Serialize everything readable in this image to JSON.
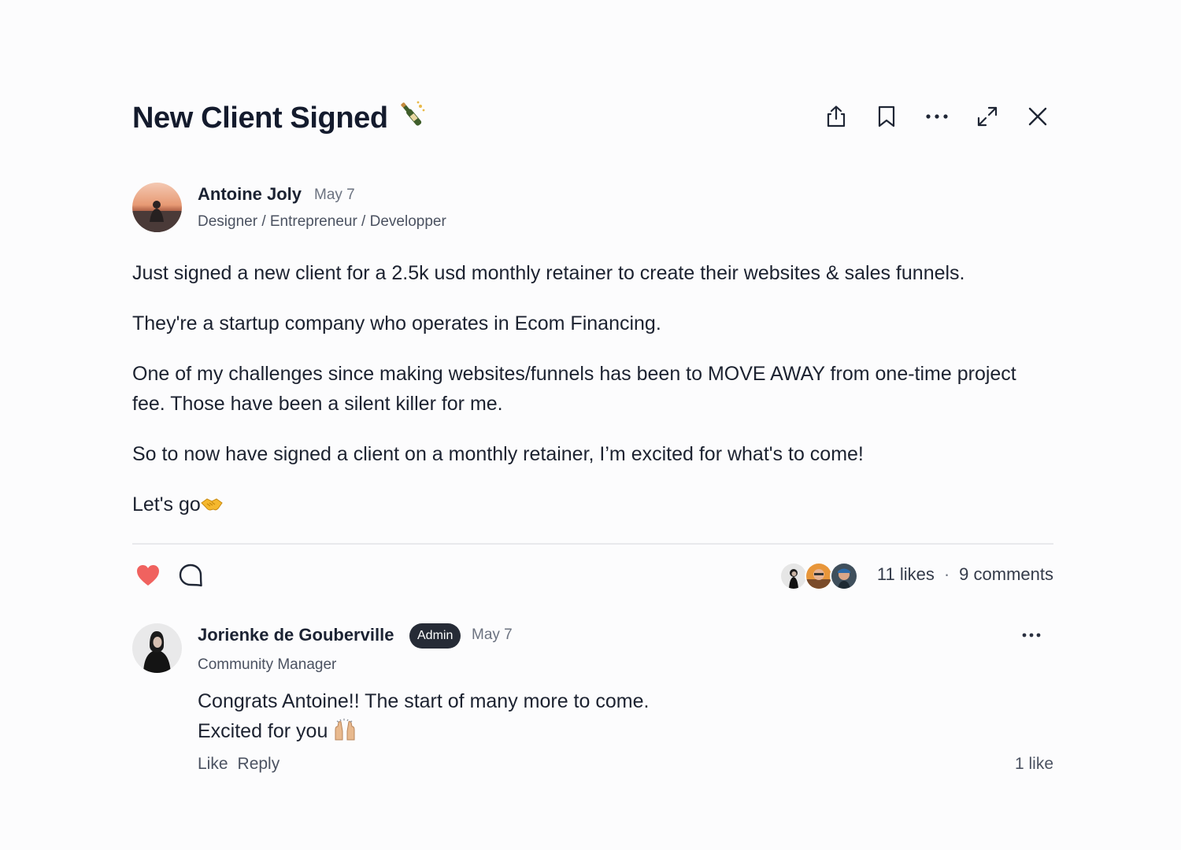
{
  "post": {
    "title": "New Client Signed",
    "title_emoji": "bottle-with-popping-cork-emoji",
    "toolbar": [
      {
        "icon": "share-icon"
      },
      {
        "icon": "bookmark-icon"
      },
      {
        "icon": "more-options-icon"
      },
      {
        "icon": "expand-icon"
      },
      {
        "icon": "close-icon"
      }
    ],
    "author": {
      "name": "Antoine Joly",
      "date": "May 7",
      "role": "Designer / Entrepreneur / Developper"
    },
    "body": {
      "p1": "Just signed a new client for a 2.5k usd monthly retainer to create their websites & sales funnels.",
      "p2": "They're a startup company who operates in Ecom Financing.",
      "p3": "One of my challenges since making websites/funnels has been to MOVE AWAY from one-time project fee. Those have been a silent killer for me.",
      "p4": "So to now have signed a client on a monthly retainer, I’m excited for what's to come!",
      "p5": "Let's go",
      "p5_emoji": "handshake-emoji"
    },
    "reactions": {
      "liked": true,
      "likes": "11 likes",
      "separator": "·",
      "comments": "9 comments",
      "heart_color": "#f0625f"
    }
  },
  "comment": {
    "name": "Jorienke de Gouberville",
    "badge": "Admin",
    "date": "May 7",
    "role": "Community Manager",
    "line1": "Congrats Antoine!! The start of many more to come.",
    "line2": "Excited for you",
    "line2_emoji": "raising-hands-emoji",
    "like_label": "Like",
    "reply_label": "Reply",
    "likes": "1 like"
  }
}
